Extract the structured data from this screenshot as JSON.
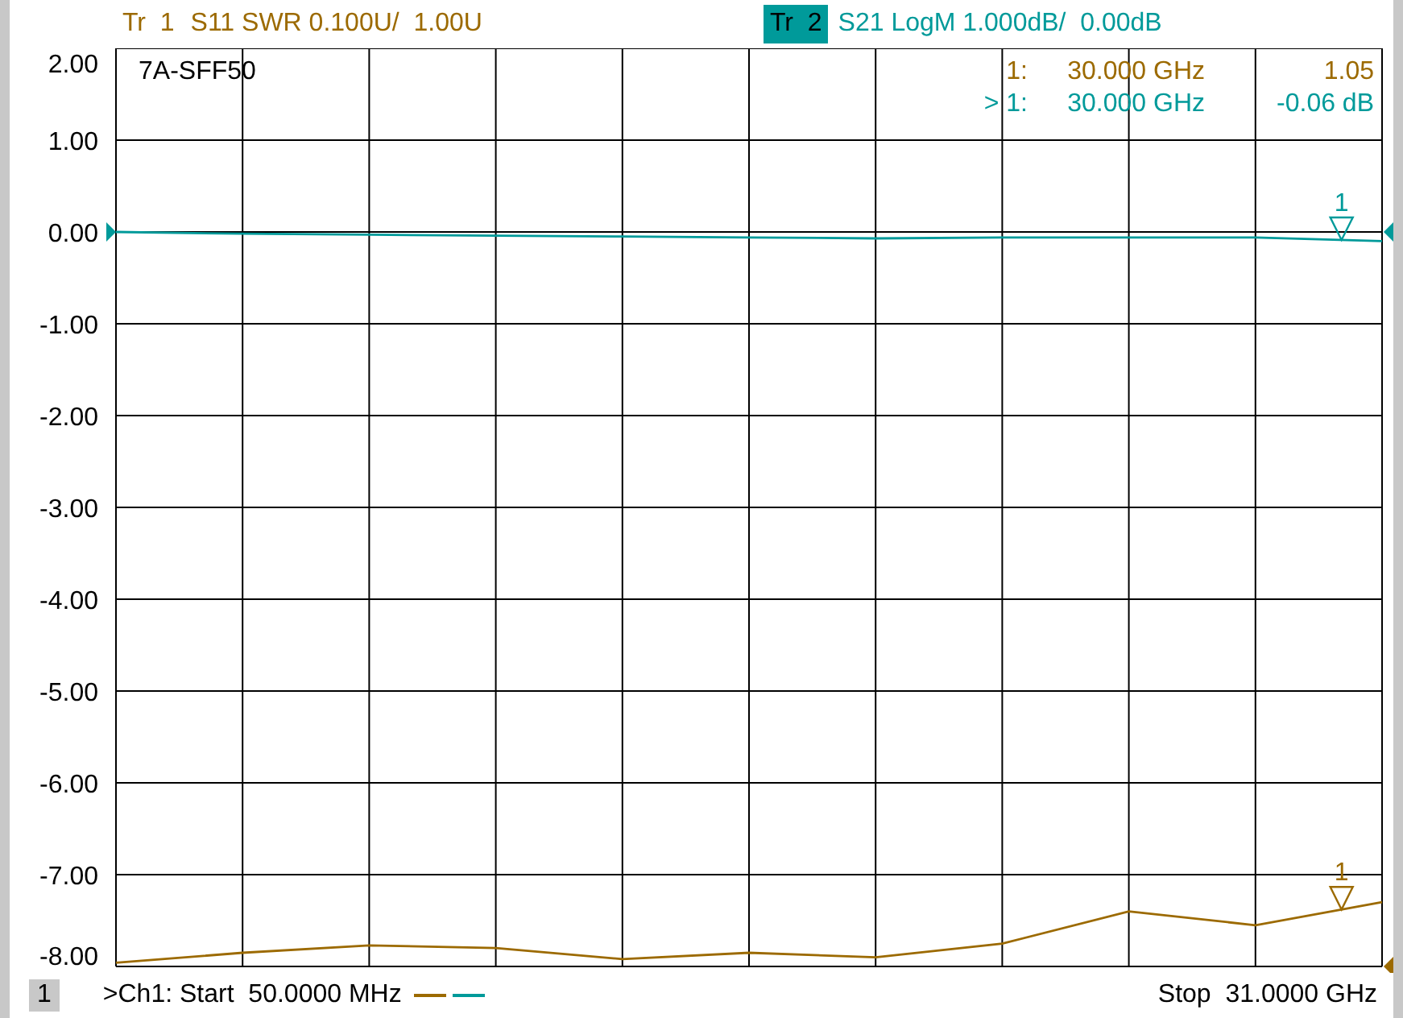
{
  "traces": [
    {
      "label": "Tr  1",
      "text": "S11 SWR 0.100U/  1.00U",
      "color": "#9c6a00",
      "selected": false
    },
    {
      "label": "Tr  2",
      "text": "S21 LogM 1.000dB/  0.00dB",
      "color": "#009a9a",
      "selected": true
    }
  ],
  "plot": {
    "title": "7A-SFF50",
    "marker_readouts": [
      {
        "label": "1:",
        "frequency": "30.000 GHz",
        "value": "1.05",
        "color": "#9c6a00"
      },
      {
        "label": "> 1:",
        "frequency": "30.000 GHz",
        "value": "-0.06 dB",
        "color": "#009a9a"
      }
    ],
    "trace_markers": [
      {
        "label": "1"
      },
      {
        "label": "1"
      }
    ],
    "chart_data": {
      "type": "line",
      "categories": [
        null,
        null,
        null,
        null,
        null,
        null,
        null,
        null,
        null,
        null,
        null
      ],
      "series": [
        {
          "color": "#009a9a",
          "values": [
            0.0,
            -0.02,
            -0.03,
            -0.04,
            -0.05,
            -0.06,
            -0.07,
            -0.06,
            -0.06,
            -0.06,
            -0.1
          ]
        },
        {
          "color": "#9c6a00",
          "values": [
            -7.96,
            -7.85,
            -7.77,
            -7.8,
            -7.92,
            -7.85,
            -7.9,
            -7.75,
            -7.4,
            -7.55,
            -7.3
          ]
        }
      ],
      "ylim": [
        -8,
        2
      ],
      "grid": true,
      "yticks": [
        {
          "value": 2,
          "label": "2.00"
        },
        {
          "value": 1,
          "label": "1.00"
        },
        {
          "value": 0,
          "label": "0.00"
        },
        {
          "value": -1,
          "label": "-1.00"
        },
        {
          "value": -2,
          "label": "-2.00"
        },
        {
          "value": -3,
          "label": "-3.00"
        },
        {
          "value": -4,
          "label": "-4.00"
        },
        {
          "value": -5,
          "label": "-5.00"
        },
        {
          "value": -6,
          "label": "-6.00"
        },
        {
          "value": -7,
          "label": "-7.00"
        },
        {
          "value": -8,
          "label": "-8.00"
        }
      ]
    }
  },
  "status_bar": {
    "channel": "1",
    "start": ">Ch1: Start  50.0000 MHz",
    "stop": "Stop  31.0000 GHz"
  }
}
